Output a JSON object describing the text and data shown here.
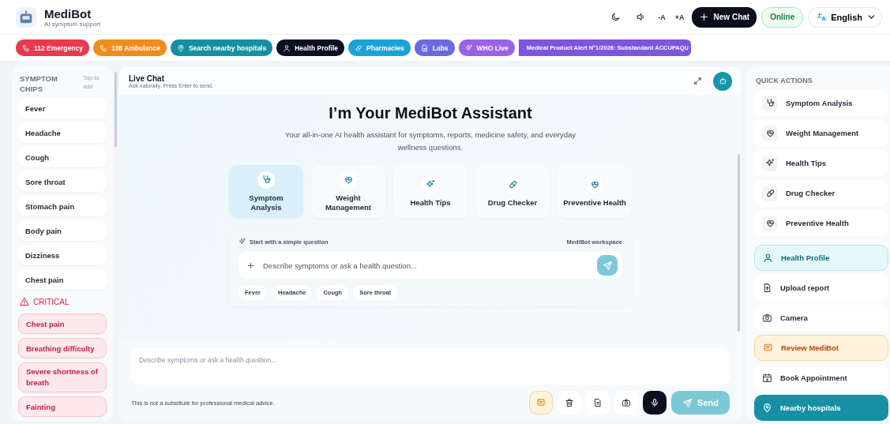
{
  "app": {
    "name": "MediBot",
    "tagline": "AI symptom support"
  },
  "header_controls": [
    {
      "kind": "icon"
    },
    {
      "kind": "icon"
    },
    {
      "kind": "text",
      "label": "-A"
    },
    {
      "kind": "text",
      "label": "+A"
    }
  ],
  "new_chat": "New Chat",
  "status": "Online",
  "language": "English",
  "quick_links": [
    {
      "label": "112 Emergency",
      "color": "#e8394f"
    },
    {
      "label": "108 Ambulance",
      "color": "#f08c1c"
    },
    {
      "label": "Search nearby hospitals",
      "color": "#1490a0"
    },
    {
      "label": "Health Profile",
      "color": "#0c1020"
    },
    {
      "label": "Pharmacies",
      "color": "#1aa3d6"
    },
    {
      "label": "Labs",
      "color": "#6a6ae0"
    },
    {
      "label": "WHO Live",
      "color": "#9a63e6"
    }
  ],
  "ticker": "Medical Product Alert N°1/2026: Substandard ACCUPAQU",
  "symptom_chips": {
    "title": "SYMPTOM CHIPS",
    "hint": "Tap to add",
    "chips": [
      "Fever",
      "Headache",
      "Cough",
      "Sore throat",
      "Stomach pain",
      "Body pain",
      "Dizziness",
      "Chest pain"
    ],
    "critical_title": "CRITICAL",
    "critical": [
      "Chest pain",
      "Breathing difficulty",
      "Severe shortness of breath",
      "Fainting"
    ]
  },
  "chat": {
    "title": "Live Chat",
    "subtitle": "Ask naturally. Press Enter to send.",
    "heading": "I’m Your MediBot Assistant",
    "intro": "Your all-in-one AI health assistant for symptoms, reports, medicine safety, and everyday wellness questions.",
    "features": [
      {
        "label": "Symptom Analysis",
        "selected": true
      },
      {
        "label": "Weight Management",
        "selected": false
      },
      {
        "label": "Health Tips",
        "selected": false
      },
      {
        "label": "Drug Checker",
        "selected": false
      },
      {
        "label": "Preventive Health",
        "selected": false
      }
    ],
    "workspace": {
      "hint": "Start with a simple question",
      "label": "MediBot workspace",
      "placeholder": "Describe symptoms or ask a health question...",
      "suggestions": [
        "Fever",
        "Headache",
        "Cough",
        "Sore throat"
      ]
    },
    "composer": {
      "placeholder": "Describe symptoms or ask a health question...",
      "disclaimer": "This is not a substitute for professional medical advice.",
      "send": "Send"
    }
  },
  "quick_actions": {
    "title": "QUICK ACTIONS",
    "items": [
      {
        "label": "Symptom Analysis",
        "kind": "shortcut"
      },
      {
        "label": "Weight Management",
        "kind": "shortcut"
      },
      {
        "label": "Health Tips",
        "kind": "shortcut"
      },
      {
        "label": "Drug Checker",
        "kind": "shortcut"
      },
      {
        "label": "Preventive Health",
        "kind": "shortcut"
      },
      {
        "label": "Health Profile",
        "kind": "accent"
      },
      {
        "label": "Upload report",
        "kind": "tool"
      },
      {
        "label": "Camera",
        "kind": "tool"
      },
      {
        "label": "Review MediBot",
        "kind": "warn"
      },
      {
        "label": "Book Appointment",
        "kind": "tool"
      },
      {
        "label": "Nearby hospitals",
        "kind": "primary"
      }
    ]
  }
}
